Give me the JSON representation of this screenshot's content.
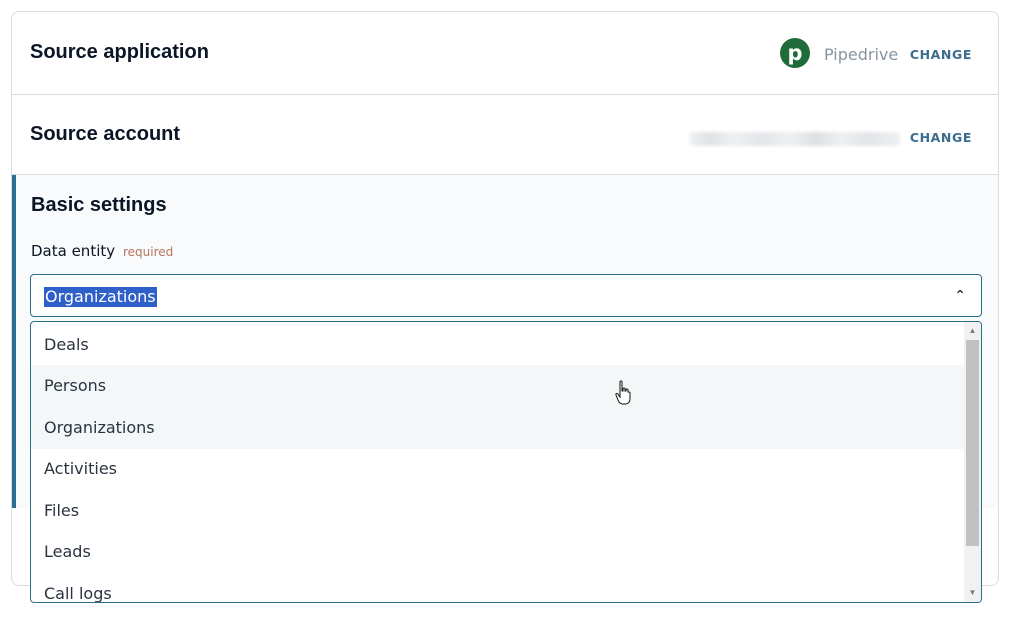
{
  "source_application": {
    "title": "Source application",
    "app_name": "Pipedrive",
    "app_logo_letter": "p",
    "change_label": "CHANGE"
  },
  "source_account": {
    "title": "Source account",
    "change_label": "CHANGE"
  },
  "basic_settings": {
    "title": "Basic settings",
    "data_entity": {
      "label": "Data entity",
      "required_label": "required",
      "selected": "Organizations",
      "options": [
        "Deals",
        "Persons",
        "Organizations",
        "Activities",
        "Files",
        "Leads",
        "Call logs"
      ]
    }
  },
  "colors": {
    "accent": "#2a6f90",
    "change_text": "#3c6c8e",
    "selection_bg": "#2f5fc9",
    "pipedrive_green": "#1f6b3a",
    "required_text": "#b97461"
  }
}
